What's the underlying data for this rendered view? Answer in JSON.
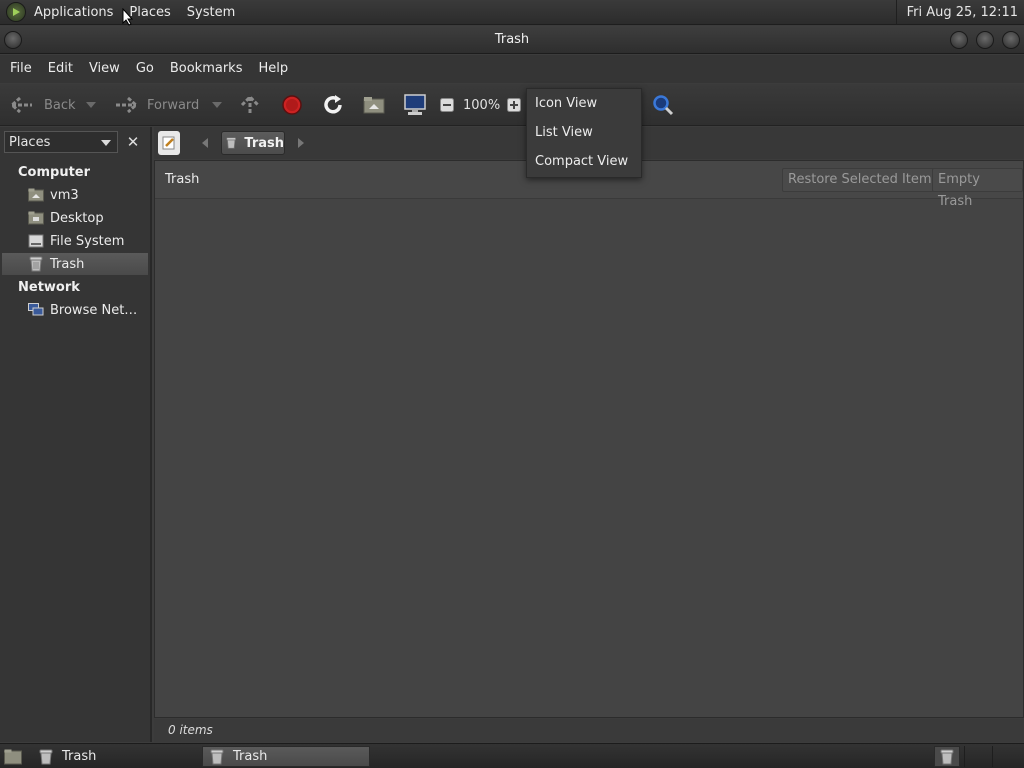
{
  "top_panel": {
    "menus": [
      "Applications",
      "Places",
      "System"
    ],
    "clock": "Fri Aug 25, 12:11"
  },
  "window": {
    "title": "Trash"
  },
  "menubar": [
    "File",
    "Edit",
    "View",
    "Go",
    "Bookmarks",
    "Help"
  ],
  "toolbar": {
    "back_label": "Back",
    "forward_label": "Forward",
    "zoom": "100%"
  },
  "view_popup": {
    "options": [
      "Icon View",
      "List View",
      "Compact View"
    ]
  },
  "sidebar": {
    "selector": "Places",
    "sections": [
      {
        "title": "Computer",
        "items": [
          "vm3",
          "Desktop",
          "File System",
          "Trash"
        ]
      },
      {
        "title": "Network",
        "items": [
          "Browse Net…"
        ]
      }
    ],
    "selected": "Trash"
  },
  "location": {
    "crumb": "Trash"
  },
  "content": {
    "info_label": "Trash",
    "restore_button": "Restore Selected Items",
    "empty_button": "Empty Trash"
  },
  "status": {
    "text": "0 items"
  },
  "taskbar": {
    "items": [
      "Trash",
      "Trash"
    ]
  },
  "colors": {
    "accent_stop": "#cc2222",
    "search_blue": "#3a78d8"
  }
}
